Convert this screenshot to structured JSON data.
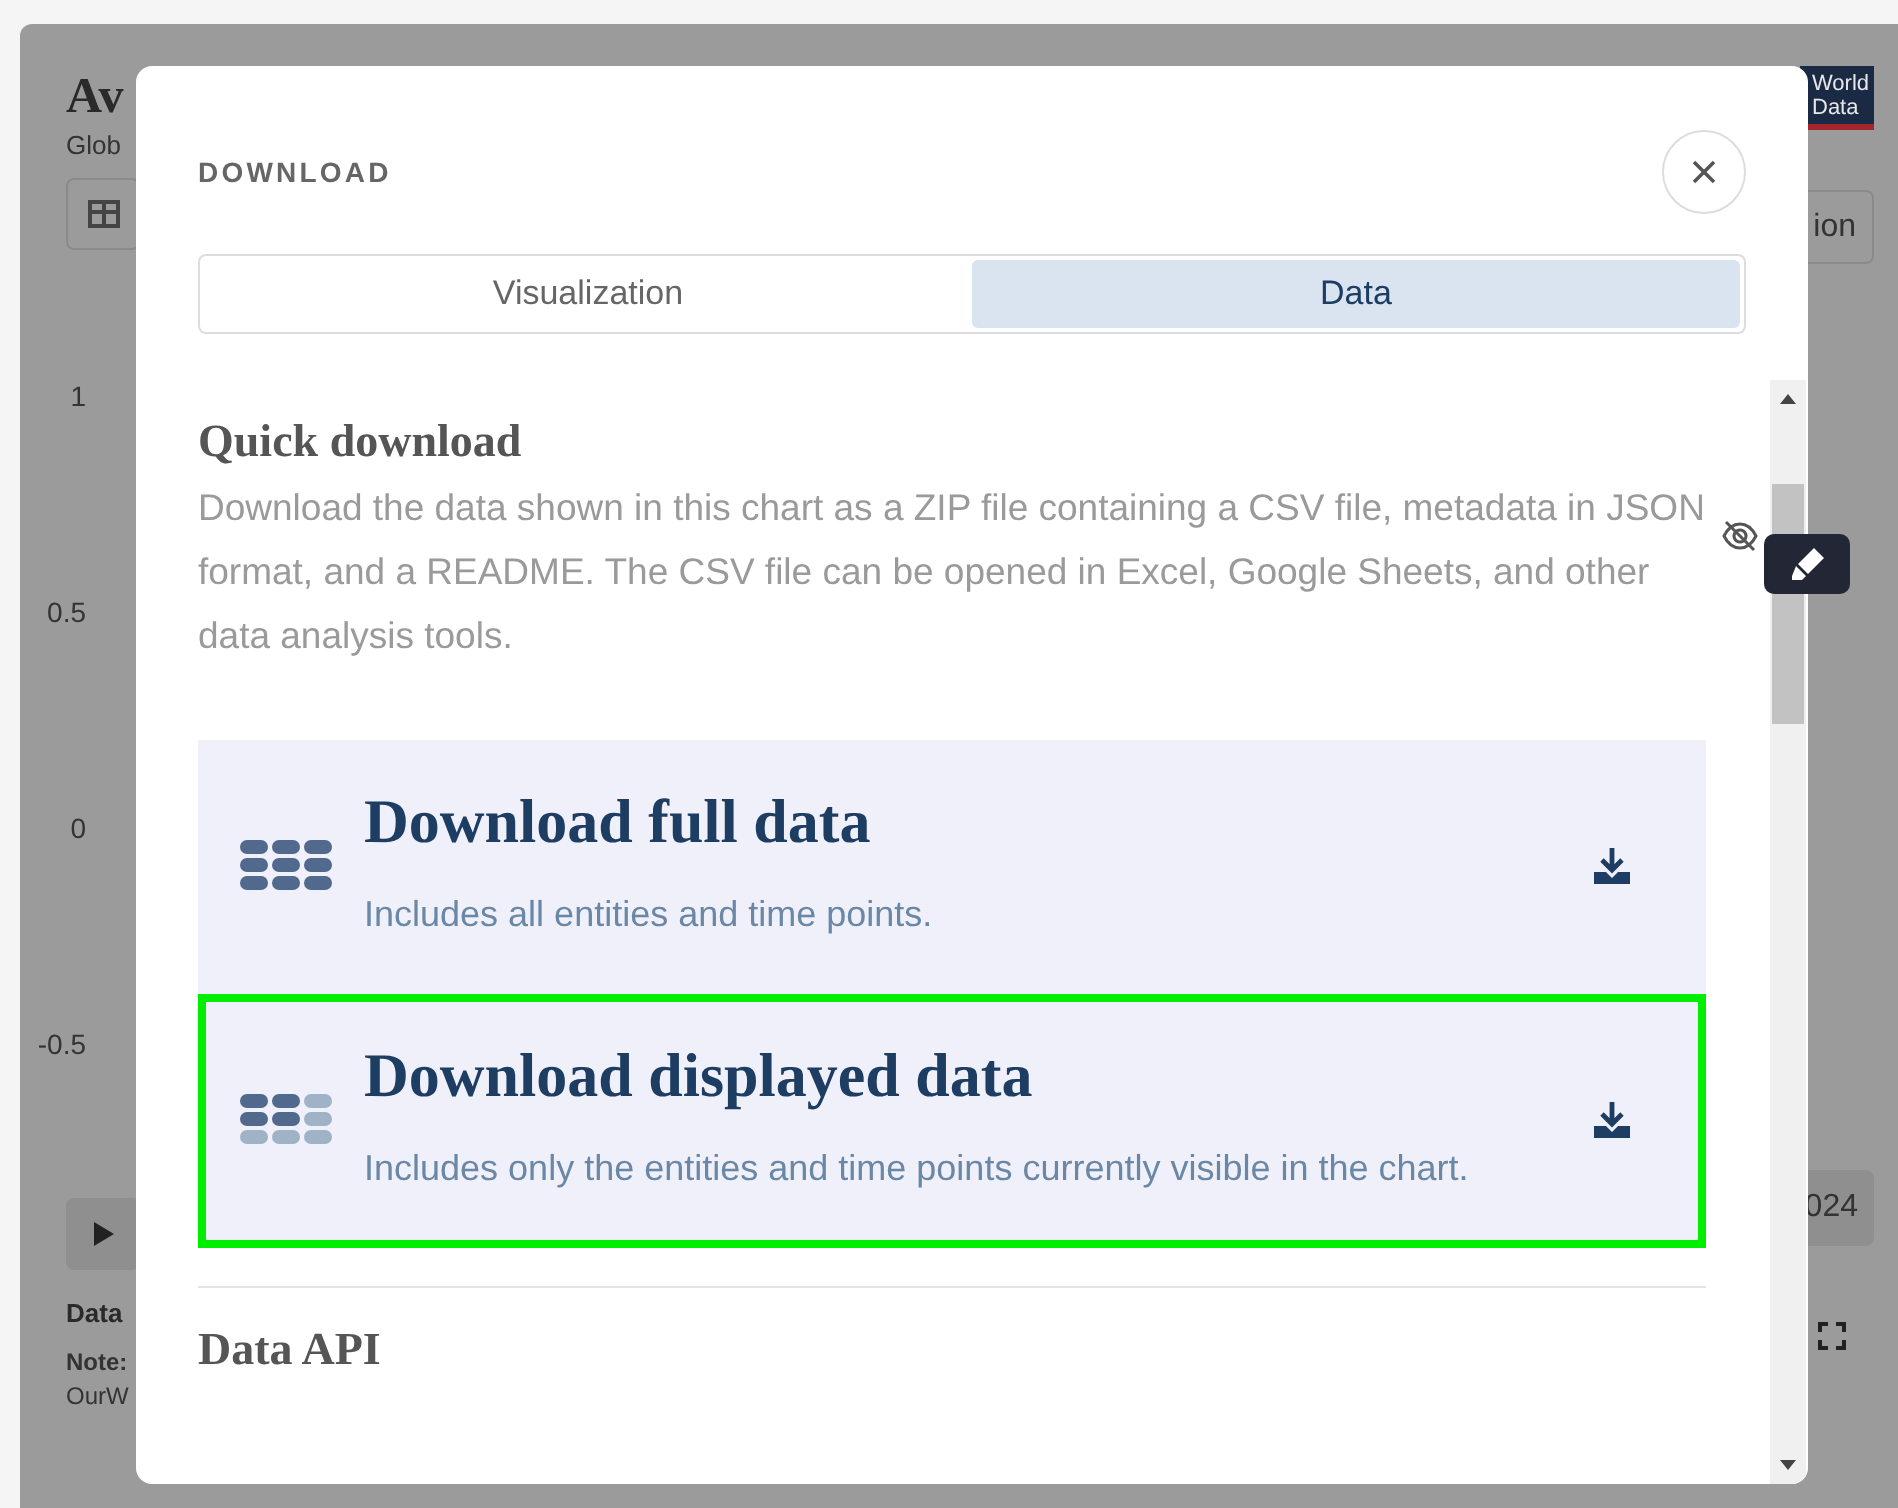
{
  "background_page": {
    "title": "Av",
    "subtitle": "Glob",
    "logo_lines": [
      "World",
      "Data"
    ],
    "right_button": "ion",
    "y_axis_labels": [
      "1",
      "0.5",
      "0",
      "-0.5"
    ],
    "time_label": "024",
    "footer_label": "Data",
    "footer_note": "Note:",
    "footer_source": "OurW"
  },
  "dialog": {
    "title": "DOWNLOAD",
    "tabs": [
      {
        "label": "Visualization",
        "selected": false
      },
      {
        "label": "Data",
        "selected": true
      }
    ],
    "sections": [
      {
        "heading": "Quick download",
        "description": "Download the data shown in this chart as a ZIP file containing a CSV file, metadata in JSON format, and a README. The CSV file can be opened in Excel, Google Sheets, and other data analysis tools.",
        "options": [
          {
            "kind": "full",
            "title": "Download full data",
            "description": "Includes all entities and time points.",
            "selected": false
          },
          {
            "kind": "displayed",
            "title": "Download displayed data",
            "description": "Includes only the entities and time points currently visible in the chart.",
            "selected": true
          }
        ]
      },
      {
        "heading": "Data API"
      }
    ]
  }
}
